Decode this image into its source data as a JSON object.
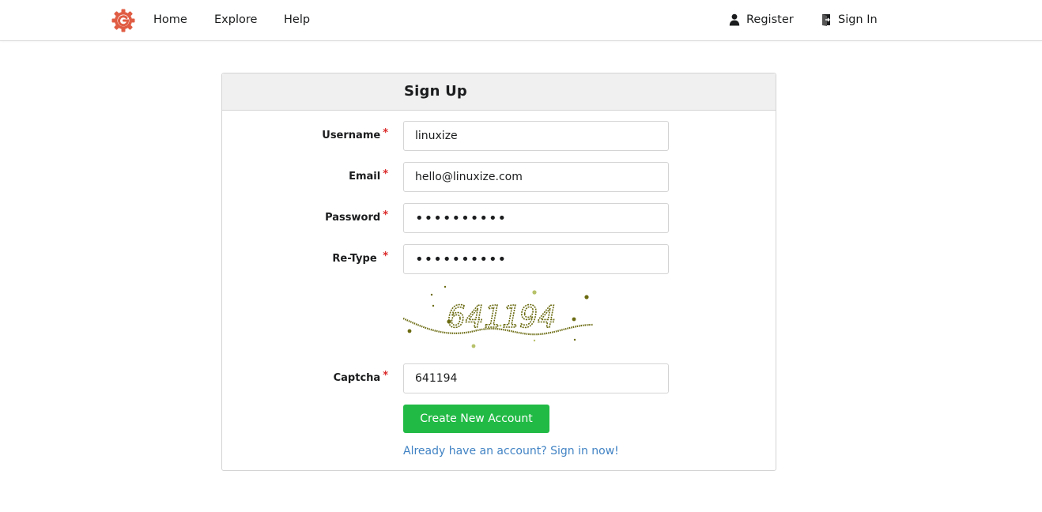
{
  "nav": {
    "logo_icon": "gitea-logo-icon",
    "brand_color": "#e05d44",
    "home": "Home",
    "explore": "Explore",
    "help": "Help",
    "register": "Register",
    "register_icon": "person-icon",
    "signin": "Sign In",
    "signin_icon": "sign-in-icon"
  },
  "form": {
    "title": "Sign Up",
    "required_mark": "*",
    "username": {
      "label": "Username",
      "value": "linuxize"
    },
    "email": {
      "label": "Email",
      "value": "hello@linuxize.com"
    },
    "password": {
      "label": "Password",
      "value": "••••••••••"
    },
    "retype": {
      "label": "Re-Type",
      "value": "••••••••••"
    },
    "captcha_image_text": "641194",
    "captcha": {
      "label": "Captcha",
      "value": "641194"
    },
    "submit": "Create New Account",
    "signin_link": "Already have an account? Sign in now!"
  },
  "colors": {
    "primary_button": "#21ba45",
    "link": "#4183c4",
    "required": "#db2828",
    "header_bg": "#f0f0f0",
    "captcha_ink": "#6b6b12"
  }
}
